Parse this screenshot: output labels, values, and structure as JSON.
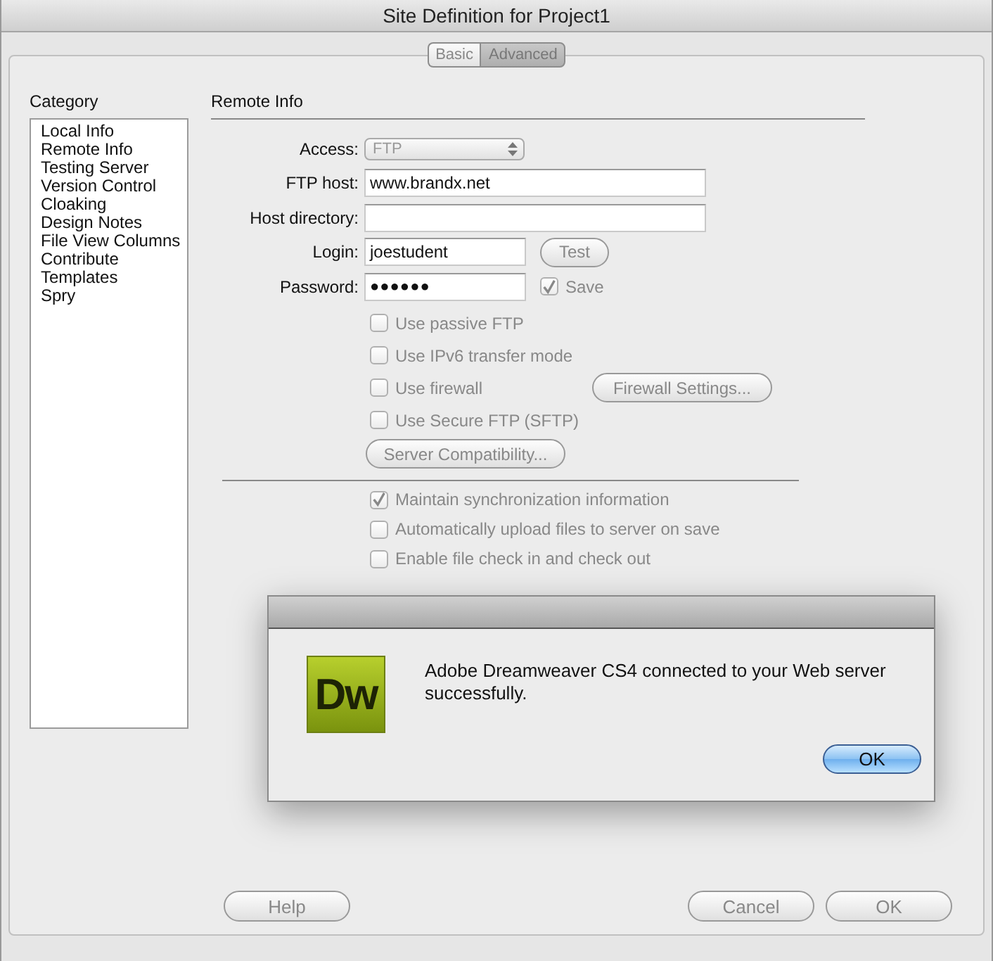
{
  "window": {
    "title": "Site Definition for Project1"
  },
  "tabs": [
    {
      "label": "Basic",
      "selected": false
    },
    {
      "label": "Advanced",
      "selected": true
    }
  ],
  "category": {
    "heading": "Category",
    "items": [
      "Local Info",
      "Remote Info",
      "Testing Server",
      "Version Control",
      "Cloaking",
      "Design Notes",
      "File View Columns",
      "Contribute",
      "Templates",
      "Spry"
    ]
  },
  "remote_info": {
    "heading": "Remote Info",
    "access": {
      "label": "Access:",
      "value": "FTP",
      "disabled": true
    },
    "ftp_host": {
      "label": "FTP host:",
      "value": "www.brandx.net"
    },
    "host_directory": {
      "label": "Host directory:"
    },
    "login": {
      "label": "Login:",
      "value": "joestudent",
      "button": {
        "label": "Test",
        "disabled": true
      }
    },
    "password": {
      "label": "Password:",
      "value": "●●●●●●",
      "save": {
        "label": "Save",
        "checked": true,
        "disabled": true
      }
    },
    "options": [
      {
        "label": "Use passive FTP",
        "checked": false,
        "disabled": true
      },
      {
        "label": "Use IPv6 transfer mode",
        "checked": false,
        "disabled": true
      },
      {
        "label": "Use firewall",
        "checked": false,
        "disabled": true,
        "button": "Firewall Settings..."
      },
      {
        "label": "Use Secure FTP (SFTP)",
        "checked": false,
        "disabled": true
      }
    ],
    "server_button": {
      "label": "Server Compatibility...",
      "disabled": true
    },
    "sync_options": [
      {
        "label": "Maintain synchronization information",
        "checked": true,
        "disabled": true
      },
      {
        "label": "Automatically upload files to server on save",
        "checked": false,
        "disabled": true
      },
      {
        "label": "Enable file check in and check out",
        "checked": false,
        "disabled": true
      }
    ]
  },
  "footer_buttons": [
    {
      "label": "Help",
      "disabled": true
    },
    {
      "label": "Cancel",
      "disabled": true
    },
    {
      "label": "OK",
      "disabled": true
    }
  ],
  "alert": {
    "logo": "Dw",
    "message": "Adobe Dreamweaver CS4 connected to your Web server successfully.",
    "button": "OK"
  }
}
